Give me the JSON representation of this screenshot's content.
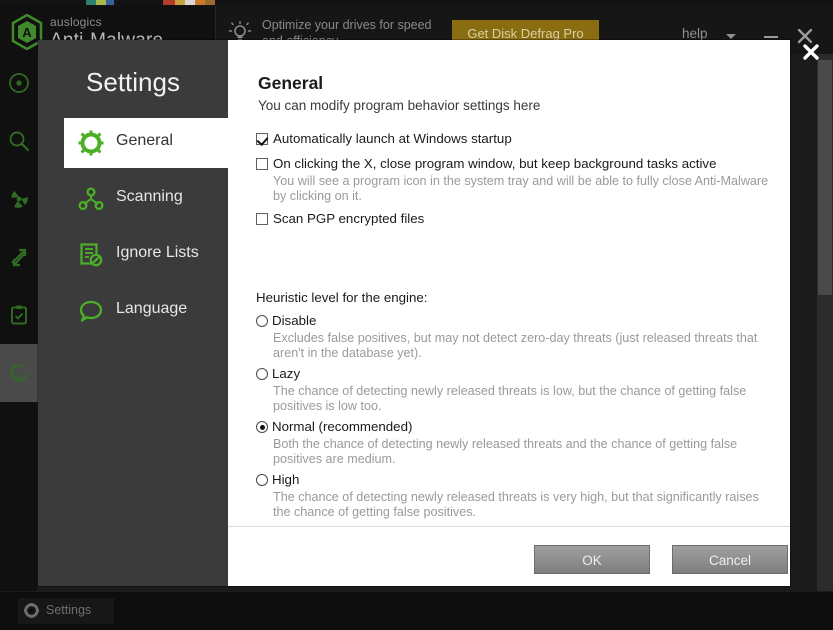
{
  "app": {
    "brand_small": "auslogics",
    "brand_big": "Anti-Malware",
    "logo_letter": "A",
    "promo_text": "Optimize your drives for speed and efficiency",
    "promo_button": "Get Disk Defrag Pro",
    "help_label": "help",
    "statusbar_settings": "Settings",
    "accent_green": "#4caf28",
    "promo_gold": "#8a6d10",
    "rail_items": [
      {
        "name": "overview-icon"
      },
      {
        "name": "scan-icon"
      },
      {
        "name": "threats-icon"
      },
      {
        "name": "tools-icon"
      },
      {
        "name": "reports-icon"
      },
      {
        "name": "update-icon"
      }
    ]
  },
  "dialog": {
    "sidebar_title": "Settings",
    "nav": [
      {
        "label": "General",
        "icon": "gear-icon",
        "active": true
      },
      {
        "label": "Scanning",
        "icon": "nodes-icon",
        "active": false
      },
      {
        "label": "Ignore Lists",
        "icon": "list-block-icon",
        "active": false
      },
      {
        "label": "Language",
        "icon": "speech-bubble-icon",
        "active": false
      }
    ],
    "section_title": "General",
    "section_subtitle": "You can modify program behavior settings here",
    "checkboxes": [
      {
        "label": "Automatically launch at Windows startup",
        "checked": true,
        "note": ""
      },
      {
        "label": "On clicking the X, close program window, but keep background tasks active",
        "checked": false,
        "note": "You will see a program icon in the system tray and will be able to fully close Anti-Malware by clicking on it."
      },
      {
        "label": "Scan PGP encrypted files",
        "checked": false,
        "note": ""
      }
    ],
    "heuristic_title": "Heuristic level for the engine:",
    "heuristic_options": [
      {
        "label": "Disable",
        "selected": false,
        "description": "Excludes false positives, but may not detect zero-day threats (just released threats that aren't in the database yet)."
      },
      {
        "label": "Lazy",
        "selected": false,
        "description": "The chance of detecting newly released threats is low, but the chance of getting false positives is low too."
      },
      {
        "label": "Normal (recommended)",
        "selected": true,
        "description": "Both the chance of detecting newly released threats and the chance of getting false positives are medium."
      },
      {
        "label": "High",
        "selected": false,
        "description": "The chance of detecting newly released threats is very high, but that significantly raises the chance of getting false positives."
      }
    ],
    "ok_label": "OK",
    "cancel_label": "Cancel"
  }
}
